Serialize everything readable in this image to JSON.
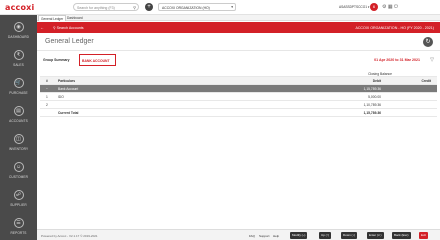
{
  "brand": {
    "logo": "accoxi"
  },
  "topbar": {
    "search_placeholder": "Search for anything (F3)",
    "add_icon": "+",
    "organization": "ACCOXI ORGANIZATION (HO)",
    "user": "ASASSDPTSCCO1 ▾",
    "notifications": "6"
  },
  "sidebar": {
    "items": [
      {
        "label": "DASHBOARD",
        "icon": "dashboard-icon"
      },
      {
        "label": "SALES",
        "icon": "sales-icon"
      },
      {
        "label": "PURCHASE",
        "icon": "purchase-icon"
      },
      {
        "label": "ACCOUNTS",
        "icon": "accounts-icon"
      },
      {
        "label": "INVENTORY",
        "icon": "inventory-icon"
      },
      {
        "label": "CUSTOMER",
        "icon": "customer-icon"
      },
      {
        "label": "SUPPLIER",
        "icon": "supplier-icon"
      },
      {
        "label": "REPORTS",
        "icon": "reports-icon"
      }
    ]
  },
  "tabs": [
    {
      "label": "General Ledger"
    },
    {
      "label": "Dashboard"
    }
  ],
  "header": {
    "search_accounts": "Search Accounts",
    "org_title": "ACCOXI ORGANIZATION - HO (FY 2020 - 2021)"
  },
  "page": {
    "title": "General Ledger"
  },
  "filters": {
    "group_summary_label": "Group Summary",
    "group_value": "BANK ACCOUNT",
    "date_range": "01 Apr 2020 to 31 Mar 2021"
  },
  "table": {
    "closing_balance": "Closing Balance",
    "columns": {
      "hash": "#",
      "particulars": "Particulars",
      "debit": "Debit",
      "credit": "Credit"
    },
    "group_row": {
      "name": "Bank Account",
      "debit": "1,15,789.36"
    },
    "rows": [
      {
        "num": "1",
        "name": "IDO",
        "debit": "5,000.00"
      },
      {
        "num": "2",
        "name": "",
        "debit": "1,10,789.36"
      }
    ],
    "total": {
      "label": "Current Total",
      "debit": "1,15,789.36"
    }
  },
  "footer": {
    "powered": "Powered by Accoxi - V2.1.17 © 2019-2021",
    "faq": "FAQ",
    "support": "Support",
    "help": "Help",
    "buttons": [
      "Modify (~)",
      "Up (↑)",
      "Down (↓)",
      "Enter (↵)",
      "Back (Esc)",
      "Exit"
    ]
  },
  "colors": {
    "accent": "#d32027",
    "sidebar": "#4a4a4a"
  }
}
